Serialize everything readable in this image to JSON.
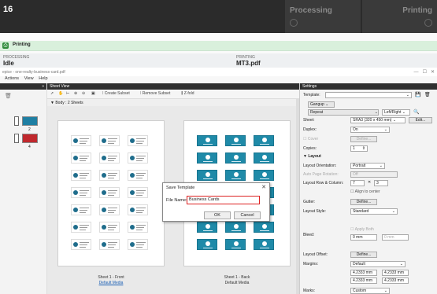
{
  "topbar": {
    "number": "16",
    "tabs": [
      "Processing",
      "Printing"
    ]
  },
  "printing_bar": {
    "label": "Printing"
  },
  "status": {
    "processing_label": "PROCESSING",
    "processing_value": "Idle",
    "printing_label": "PRINTING",
    "printing_value": "MT3.pdf"
  },
  "window": {
    "title": "epice - one-realty-business-card.pdf"
  },
  "menu": [
    "Actions",
    "View",
    "Help"
  ],
  "left_panel": {
    "header": "»",
    "pages": [
      "2",
      "4"
    ]
  },
  "sheet_view": {
    "header": "Sheet View",
    "toolbar": {
      "create_subset": "Create Subset",
      "remove_subset": "Remove Subset",
      "zfold": "Z-fold"
    },
    "body_label": "Body : 2 Sheets",
    "sheet1_label": "Sheet 1 - Front",
    "sheet1_media": "Default Media",
    "sheet2_label": "Sheet 1 - Back",
    "sheet2_media": "Default Media"
  },
  "settings": {
    "header": "Settings",
    "template_label": "Template:",
    "gangup": "Gangup",
    "repeat": "Repeat",
    "alignment": "Left/Right",
    "sheet_label": "Sheet:",
    "sheet_value": "SRA3 (320 x 450 mm)",
    "edit_button": "Edit...",
    "duplex_label": "Duplex:",
    "duplex_value": "On",
    "cover_label": "Cover",
    "define_label": "Define...",
    "copies_label": "Copies:",
    "copies_value": "1",
    "layout_section": "Layout",
    "orientation_label": "Layout Orientation:",
    "orientation_value": "Portrait",
    "auto_rotation_label": "Auto Page Rotation:",
    "auto_rotation_value": "Off",
    "row_col_label": "Layout Row & Column:",
    "rows": "7",
    "cols": "3",
    "align_center": "Align to center",
    "gutter_label": "Gutter:",
    "gutter_button": "Define...",
    "style_label": "Layout Style:",
    "style_value": "Standard",
    "bleed_label": "Bleed:",
    "apply_both": "Apply Both",
    "bleed_a": "0 mm",
    "bleed_b": "0 mm",
    "offset_label": "Layout Offset:",
    "offset_button": "Define...",
    "margins_label": "Margins:",
    "margins_value": "Default",
    "margin_1": "4.2333 mm",
    "margin_2": "4.2333 mm",
    "margin_3": "4.2333 mm",
    "margin_4": "4.2333 mm",
    "marks_label": "Marks:",
    "marks_value": "Custom"
  },
  "dialog": {
    "title": "Save Template",
    "field_label": "File Name:",
    "field_value": "Business Cards",
    "ok": "OK",
    "cancel": "Cancel"
  },
  "colors": {
    "accent": "#1f8aa8",
    "printing_bg": "#d9f0dc",
    "highlight": "#dd2222"
  }
}
